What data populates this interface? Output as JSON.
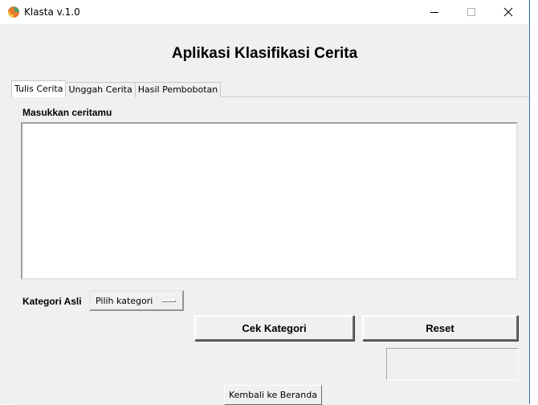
{
  "window": {
    "title": "Klasta v.1.0",
    "icons": {
      "app": "app-logo-icon",
      "minimize": "minimize-icon",
      "maximize": "maximize-icon",
      "close": "close-icon"
    }
  },
  "header": {
    "title": "Aplikasi Klasifikasi Cerita"
  },
  "tabs": [
    {
      "label": "Tulis Cerita",
      "active": true
    },
    {
      "label": "Unggah Cerita",
      "active": false
    },
    {
      "label": "Hasil Pembobotan",
      "active": false
    }
  ],
  "form": {
    "story_label": "Masukkan ceritamu",
    "story_value": "",
    "category_label": "Kategori Asli",
    "category_selected": "Pilih kategori",
    "check_button": "Cek Kategori",
    "reset_button": "Reset",
    "result_value": ""
  },
  "footer": {
    "back_button": "Kembali ke Beranda"
  },
  "colors": {
    "window_bg": "#f0f0f0",
    "titlebar_bg": "#ffffff",
    "border_accent": "#2b6cb3"
  }
}
